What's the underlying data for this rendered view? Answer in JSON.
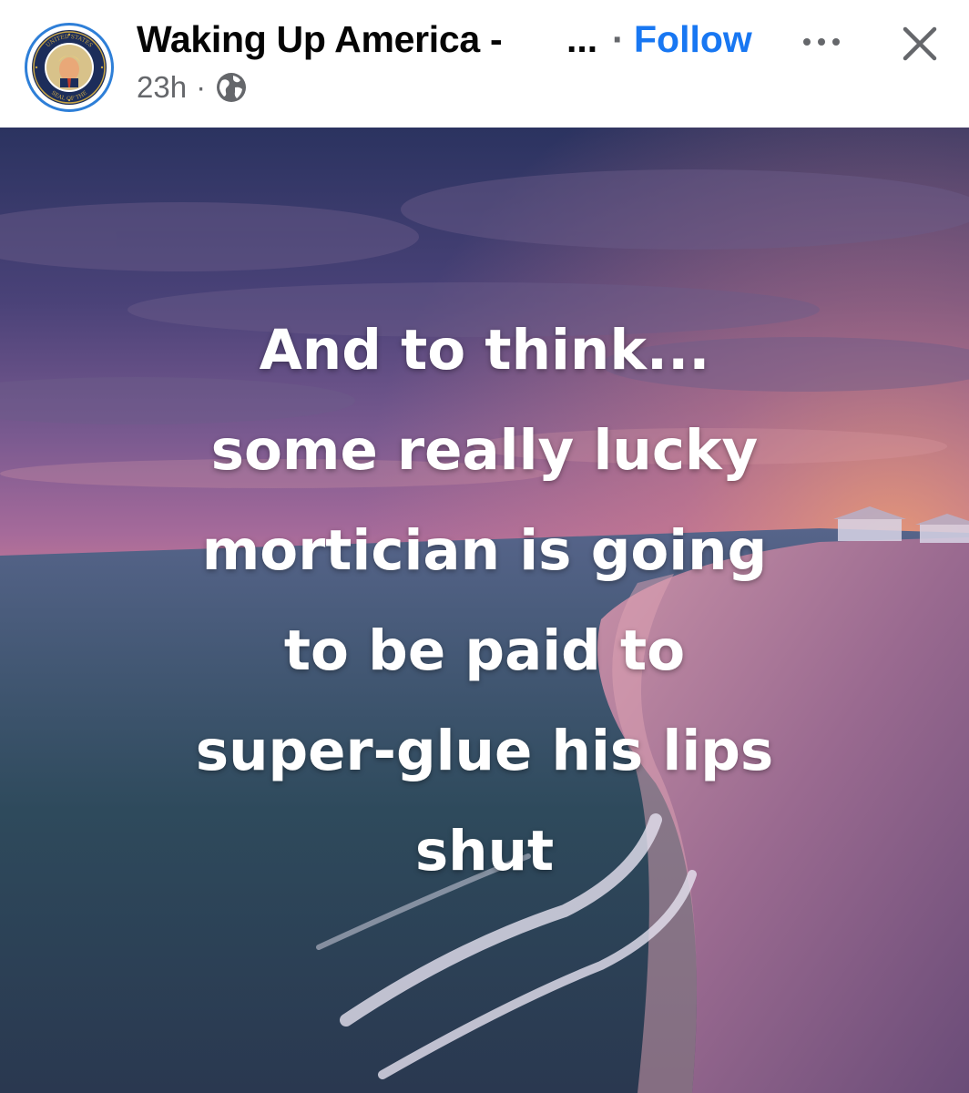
{
  "post": {
    "page_name": "Waking Up America -",
    "name_truncation": "...",
    "separator": "·",
    "follow_label": "Follow",
    "timestamp": "23h",
    "meta_separator": "·",
    "audience_icon": "globe-icon",
    "more_icon": "more-options-icon",
    "close_icon": "close-icon",
    "avatar_icon": "presidential-seal-avatar",
    "avatar_seal_text": "SEAL OF THE PUSSY ASS BITCH OF THE UNITED STATES"
  },
  "image": {
    "quote_lines": [
      "And to think...",
      "some really lucky",
      "mortician is going",
      "to be paid to",
      "super-glue his lips",
      "shut"
    ]
  },
  "colors": {
    "follow": "#1877f2",
    "secondary_text": "#65676b",
    "avatar_ring": "#2e7fd8",
    "seal_navy": "#1c2d5a",
    "seal_gold": "#c9a646"
  }
}
